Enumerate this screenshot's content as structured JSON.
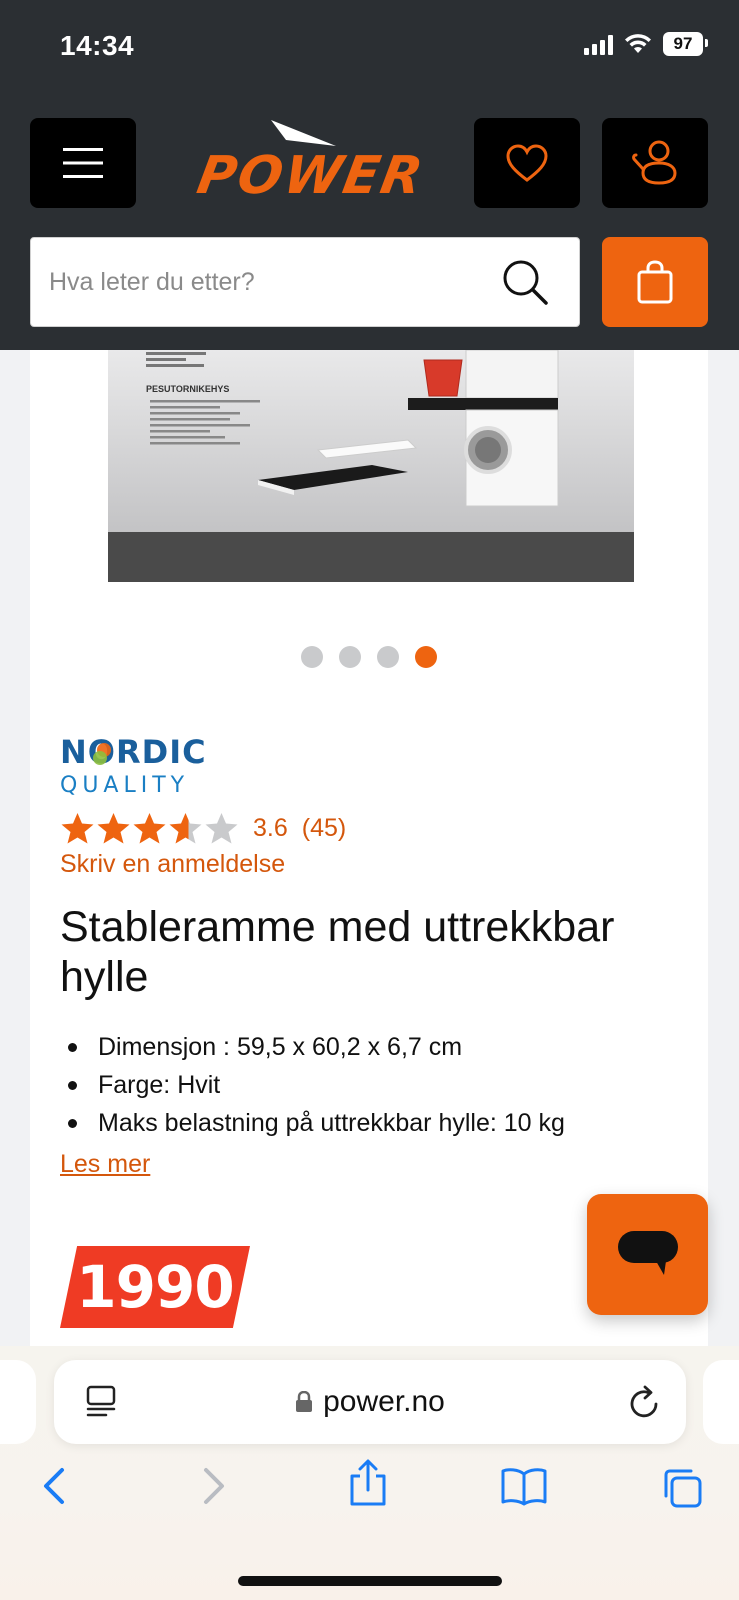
{
  "status_bar": {
    "time": "14:34",
    "battery": "97"
  },
  "header": {
    "logo_text": "POWER",
    "search_placeholder": "Hva leter du etter?"
  },
  "gallery": {
    "dot_count": 4,
    "active_index": 3
  },
  "product": {
    "brand_line1": "NORDIC",
    "brand_line2": "QUALITY",
    "rating_value": "3.6",
    "rating_stars": 3.6,
    "rating_count": "(45)",
    "write_review": "Skriv en anmeldelse",
    "title": "Stableramme med uttrekkbar hylle",
    "features": [
      "Dimensjon : 59,5 x 60,2 x 6,7 cm",
      "Farge: Hvit",
      "Maks belastning på uttrekkbar hylle: 10 kg"
    ],
    "read_more": "Les mer",
    "price": "1990",
    "image_text": "PESUTORNIKEHYS"
  },
  "browser": {
    "url": "power.no"
  },
  "colors": {
    "accent": "#ee6410",
    "price_red": "#ef3b24",
    "header_bg": "#2b2f33",
    "ios_blue": "#1a7cf5"
  }
}
